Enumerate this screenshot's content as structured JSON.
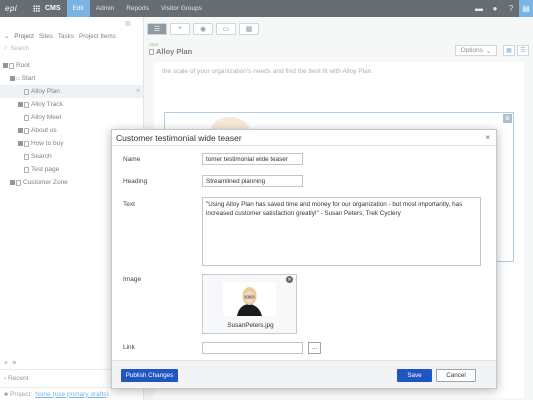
{
  "topbar": {
    "logo": "epi",
    "app_name": "CMS",
    "nav": [
      "Edit",
      "Admin",
      "Reports",
      "Visitor Groups"
    ],
    "active_nav": "Edit",
    "icons": [
      "comment-icon",
      "bell-icon",
      "user-menu-icon"
    ]
  },
  "left_nav": {
    "tabs": [
      "Project",
      "Sites",
      "Tasks",
      "Project Items"
    ],
    "search_placeholder": "Search",
    "tree": [
      {
        "label": "Root",
        "level": 0
      },
      {
        "label": "Start",
        "level": 1
      },
      {
        "label": "Alloy Plan",
        "level": 2,
        "selected": true
      },
      {
        "label": "Alloy Track",
        "level": 2
      },
      {
        "label": "Alloy Meet",
        "level": 2
      },
      {
        "label": "About us",
        "level": 2
      },
      {
        "label": "How to buy",
        "level": 2
      },
      {
        "label": "Search",
        "level": 2
      },
      {
        "label": "Test page",
        "level": 2
      },
      {
        "label": "Customer Zone",
        "level": 1
      }
    ],
    "recent_label": "Recent",
    "project_label": "Project:",
    "project_name": "None (use primary drafts)"
  },
  "main": {
    "page_label": "Start",
    "page_title": "Alloy Plan",
    "options_label": "Options",
    "intro_text": "the scale of your organization's needs and find the best fit with Alloy Plan."
  },
  "dialog": {
    "title": "Customer testimonial wide teaser",
    "fields": {
      "name_label": "Name",
      "name_value": "tomer testimonial wide teaser",
      "heading_label": "Heading",
      "heading_value": "Streamlined planning",
      "text_label": "Text",
      "text_value": "\"Using Alloy Plan has saved time and money for our organization - but most importantly, has increased customer satisfaction greatly!\" - Susan Peters, Trek Cyclery",
      "image_label": "Image",
      "image_file": "SusanPeters.jpg",
      "link_label": "Link",
      "link_value": ""
    },
    "buttons": {
      "publish": "Publish Changes",
      "save": "Save",
      "cancel": "Cancel"
    }
  }
}
